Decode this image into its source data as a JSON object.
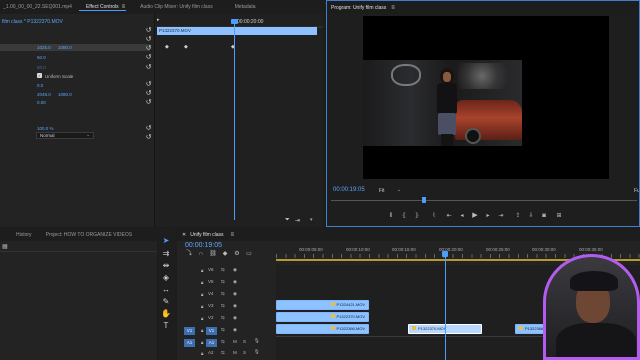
{
  "effect_controls": {
    "tabs": [
      "_1.00_00_00_22.SEQ001.mp4",
      "Effect Controls",
      "Audio Clip Mixer: Unify film class",
      "Metadata"
    ],
    "source_label": "film class * P1322370.MOV",
    "timecode_ruler": "00:00:20:00",
    "clip_label": "P1322370.MOV",
    "values": {
      "position_x": "1025.0",
      "position_y": "1080.0",
      "scale": "50.0",
      "scale_width": "50.0",
      "uniform_scale": "Uniform Scale",
      "rotation": "0.0",
      "anchor_x": "2048.0",
      "anchor_y": "1080.0",
      "flicker": "0.00",
      "opacity": "100.0 %",
      "blend_mode": "Normal"
    }
  },
  "program_monitor": {
    "title": "Program: Unify film class",
    "timecode": "00:00:19:05",
    "fit": "Fit",
    "full_label": "Fu"
  },
  "bottom_left": {
    "tabs": [
      "History",
      "Project: HOW TO ORGANIZE VIDEOS"
    ]
  },
  "timeline": {
    "tab": "Unify film class",
    "timecode": "00:00:19:05",
    "ruler_labels": [
      "00:00:05:00",
      "00:00:10:00",
      "00:00:15:00",
      "00:00:20:00",
      "00:00:25:00",
      "00:00:30:00",
      "00:00:35:00"
    ],
    "tracks": [
      "V6",
      "V5",
      "V4",
      "V3",
      "V2",
      "V1",
      "A1",
      "A2",
      "A3"
    ],
    "source_patch_v": "V1",
    "source_patch_a": "A1",
    "clips": [
      {
        "label": "P1324421.MOV",
        "track": "V3"
      },
      {
        "label": "P1322370.MOV",
        "track": "V2"
      },
      {
        "label": "P1322366.MOV",
        "track": "V1"
      },
      {
        "label": "P1322370.MOV",
        "track": "V1"
      },
      {
        "label": "P1322366",
        "track": "V1"
      }
    ]
  },
  "colors": {
    "accent": "#4d9dff",
    "clip_fill": "#8ec1ff",
    "clip_selected": "#b9d8ff",
    "panel_bg": "#232323",
    "frame_bg": "#1d1d1d",
    "marker": "#e3c24b"
  }
}
